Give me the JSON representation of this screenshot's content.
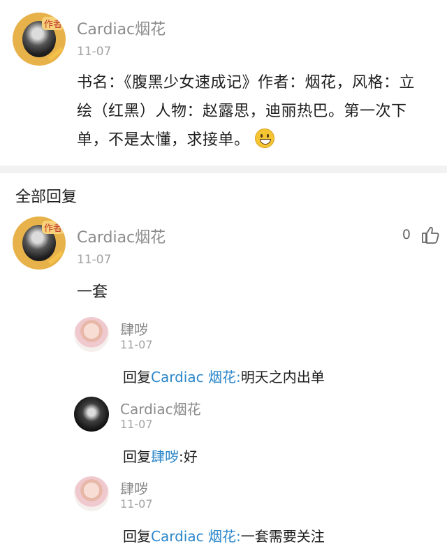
{
  "post": {
    "author": "Cardiac烟花",
    "avatar_badge": "作者",
    "date": "11-07",
    "text": "书名：《腹黑少女速成记》作者：烟花，风格：立绘（红黑）人物：赵露思，迪丽热巴。第一次下单，不是太懂，求接单。",
    "emoji": "grinning-face"
  },
  "replies_section": {
    "title": "全部回复"
  },
  "comment": {
    "author": "Cardiac烟花",
    "avatar_badge": "作者",
    "date": "11-07",
    "text": "一套",
    "like_count": "0",
    "like_icon": "thumbs-up-icon"
  },
  "replies": [
    {
      "author": "肆哕",
      "date": "11-07",
      "prefix": "回复",
      "mention": "Cardiac 烟花",
      "colon": ":",
      "content": "明天之内出单"
    },
    {
      "author": "Cardiac烟花",
      "date": "11-07",
      "prefix": "回复",
      "mention": "肆哕",
      "colon": ":",
      "content": "好"
    },
    {
      "author": "肆哕",
      "date": "11-07",
      "prefix": "回复",
      "mention": "Cardiac 烟花",
      "colon": ":",
      "content": "一套需要关注"
    }
  ],
  "colors": {
    "link": "#2a86c9",
    "name": "#8b8b8b",
    "divider": "#f2f2f2"
  }
}
